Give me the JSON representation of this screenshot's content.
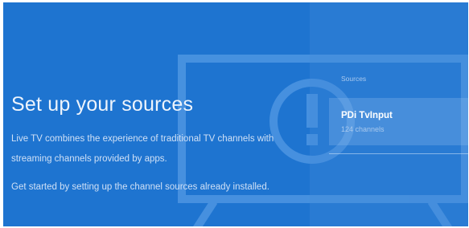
{
  "setup": {
    "title": "Set up your sources",
    "description": "Live TV combines the experience of traditional TV channels with streaming channels provided by apps.",
    "instruction": "Get started by setting up the channel sources already installed."
  },
  "sources_panel": {
    "heading": "Sources",
    "items": [
      {
        "name": "PDi TvInput",
        "subtitle": "124 channels"
      }
    ]
  },
  "colors": {
    "background": "#1e74d0",
    "illustration": "#4e96e2",
    "text_primary": "#eef4fc",
    "text_secondary": "#cfe0f6"
  },
  "icons": [
    "tv-illustration-icon",
    "alert-exclamation-icon"
  ]
}
